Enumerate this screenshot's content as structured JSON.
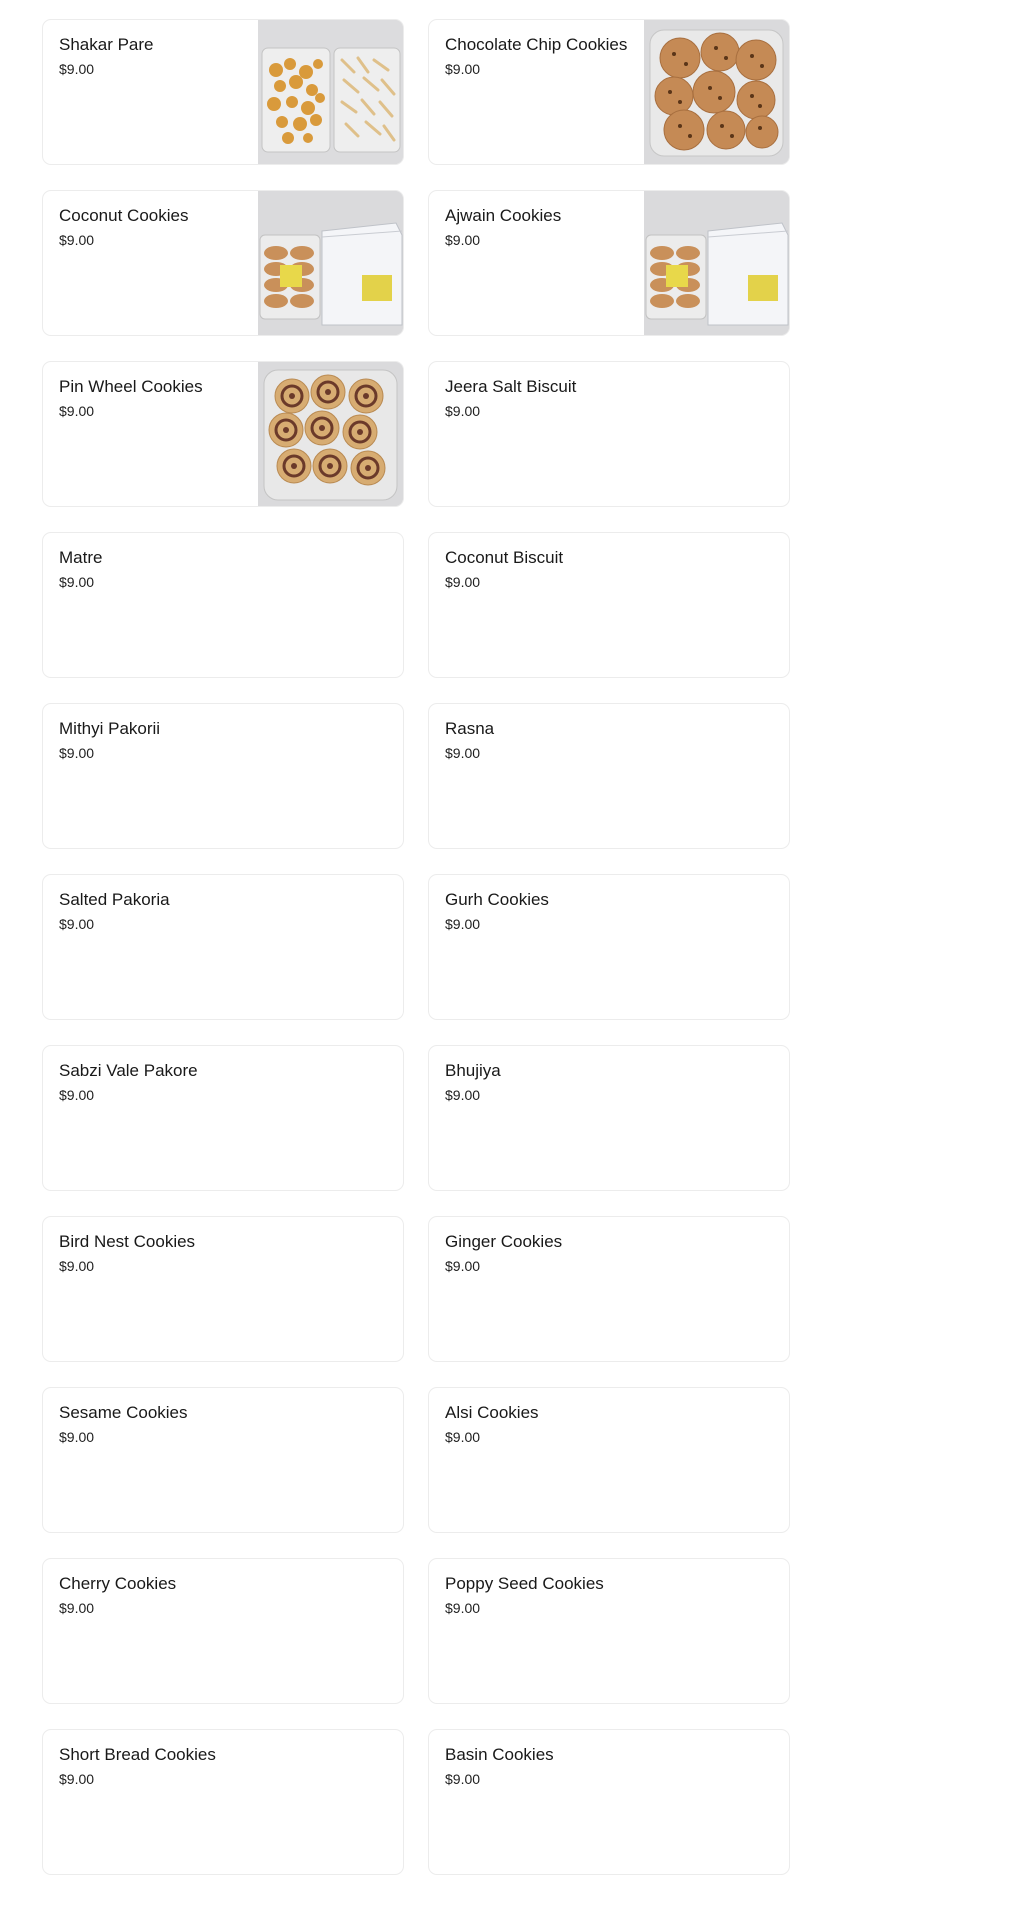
{
  "menu": {
    "items": [
      {
        "name": "",
        "price": "",
        "photo": "blank"
      },
      {
        "name": "",
        "price": "",
        "photo": "blank"
      },
      {
        "name": "Shakar Pare",
        "price": "$9.00",
        "photo": "shakar-pare-tray"
      },
      {
        "name": "Chocolate Chip Cookies",
        "price": "$9.00",
        "photo": "chocolate-chip-cookies-box"
      },
      {
        "name": "Coconut Cookies",
        "price": "$9.00",
        "photo": "cookies-with-white-box"
      },
      {
        "name": "Ajwain Cookies",
        "price": "$9.00",
        "photo": "cookies-with-white-box"
      },
      {
        "name": "Pin Wheel Cookies",
        "price": "$9.00",
        "photo": "pinwheel-cookies-box"
      },
      {
        "name": "Jeera Salt Biscuit",
        "price": "$9.00",
        "photo": null
      },
      {
        "name": "Matre",
        "price": "$9.00",
        "photo": null
      },
      {
        "name": "Coconut Biscuit",
        "price": "$9.00",
        "photo": null
      },
      {
        "name": "Mithyi Pakorii",
        "price": "$9.00",
        "photo": null
      },
      {
        "name": "Rasna",
        "price": "$9.00",
        "photo": null
      },
      {
        "name": "Salted Pakoria",
        "price": "$9.00",
        "photo": null
      },
      {
        "name": "Gurh Cookies",
        "price": "$9.00",
        "photo": null
      },
      {
        "name": "Sabzi Vale Pakore",
        "price": "$9.00",
        "photo": null
      },
      {
        "name": "Bhujiya",
        "price": "$9.00",
        "photo": null
      },
      {
        "name": "Bird Nest Cookies",
        "price": "$9.00",
        "photo": null
      },
      {
        "name": "Ginger Cookies",
        "price": "$9.00",
        "photo": null
      },
      {
        "name": "Sesame Cookies",
        "price": "$9.00",
        "photo": null
      },
      {
        "name": "Alsi Cookies",
        "price": "$9.00",
        "photo": null
      },
      {
        "name": "Cherry Cookies",
        "price": "$9.00",
        "photo": null
      },
      {
        "name": "Poppy Seed Cookies",
        "price": "$9.00",
        "photo": null
      },
      {
        "name": "Short Bread Cookies",
        "price": "$9.00",
        "photo": null
      },
      {
        "name": "Basin Cookies",
        "price": "$9.00",
        "photo": null
      }
    ]
  },
  "colors": {
    "card_border": "#ececec",
    "photo_background": "#d6d6d8",
    "text": "#191919"
  }
}
